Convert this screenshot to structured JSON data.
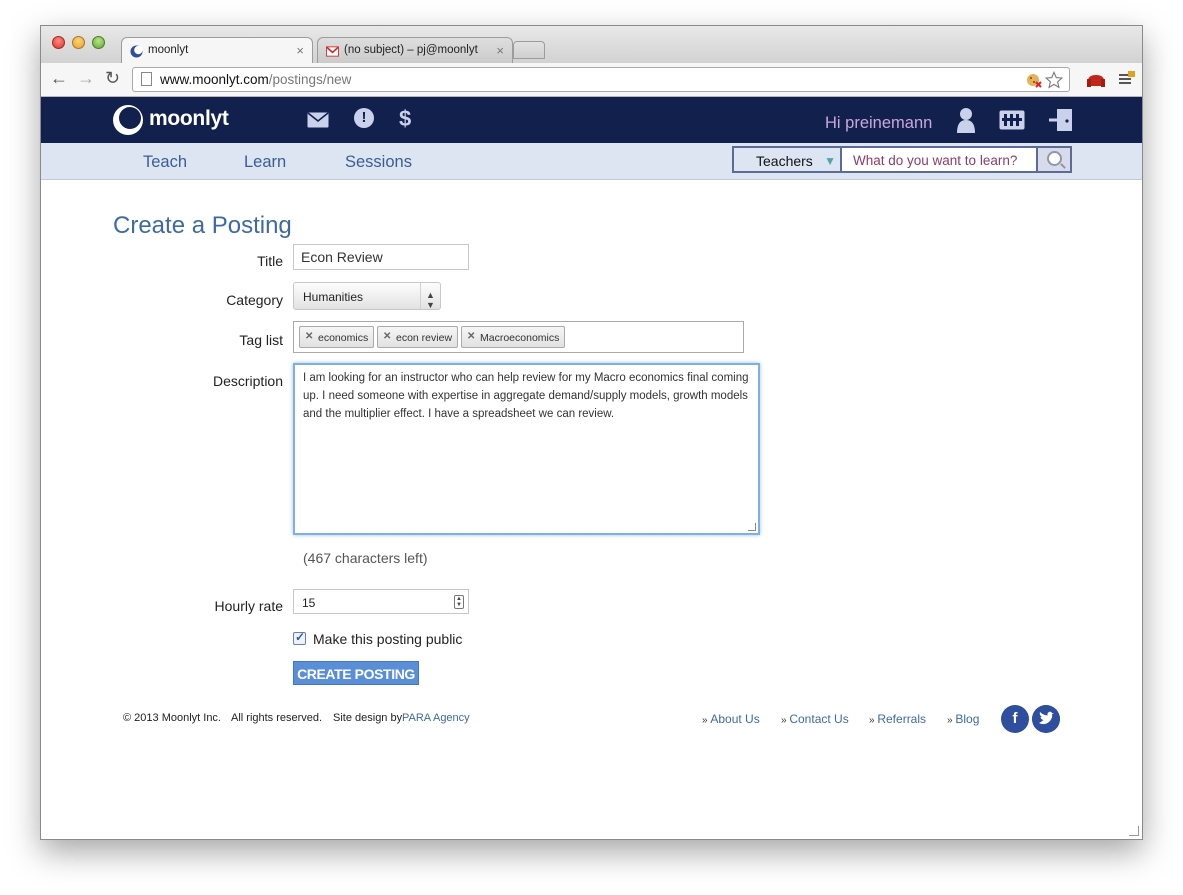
{
  "browser": {
    "tabs": [
      {
        "label": "moonlyt"
      },
      {
        "label": "(no subject) – pj@moonlyt"
      }
    ],
    "close_glyph": "×",
    "url_host": "www.moonlyt.com",
    "url_path": "/postings/new",
    "back_glyph": "←",
    "forward_glyph": "→",
    "reload_glyph": "↻"
  },
  "site": {
    "logo_text": "moonlyt",
    "header_icons": [
      "mail-icon",
      "alert-icon",
      "dollar-icon"
    ],
    "dollar_glyph": "$",
    "alert_glyph": "!",
    "greeting": "Hi preinemann",
    "nav": [
      "Teach",
      "Learn",
      "Sessions"
    ],
    "search": {
      "scope": "Teachers",
      "placeholder": "What do you want to learn?"
    },
    "colors": {
      "header_bg": "#12204e",
      "nav_bg": "#dde5f2",
      "accent": "#3e6aa1",
      "button": "#5a8fd8"
    }
  },
  "form": {
    "title": "Create a Posting",
    "labels": {
      "title": "Title",
      "category": "Category",
      "tags": "Tag list",
      "description": "Description",
      "rate": "Hourly rate"
    },
    "title_value": "Econ Review",
    "category_value": "Humanities",
    "tags": [
      "economics",
      "econ review",
      "Macroeconomics"
    ],
    "description_value": "I am looking for an instructor who can help review for my Macro economics final coming up. I need someone with expertise in aggregate demand/supply models, growth models and the multiplier effect. I have a spreadsheet we can review.",
    "chars_left": "(467 characters left)",
    "rate_value": "15",
    "public_label": "Make this posting public",
    "public_checked": true,
    "submit_label": "CREATE POSTING"
  },
  "footer": {
    "copyright": "© 2013 Moonlyt Inc.",
    "rights": "All rights reserved.",
    "design_prefix": "Site design by",
    "design_link": "PARA Agency",
    "links": [
      "About Us",
      "Contact Us",
      "Referrals",
      "Blog"
    ],
    "social": [
      "facebook-icon",
      "twitter-icon"
    ]
  }
}
